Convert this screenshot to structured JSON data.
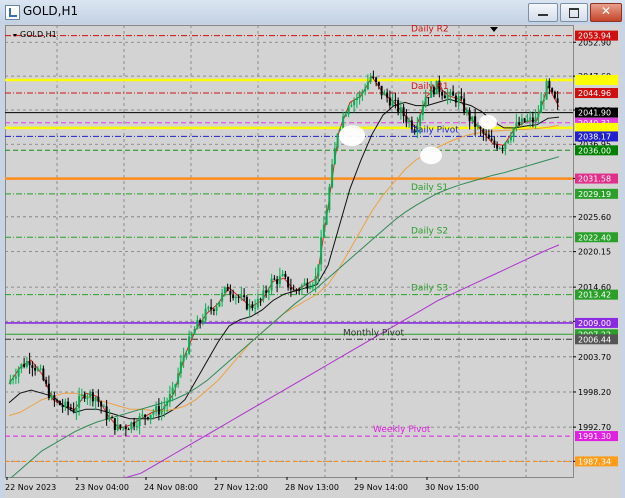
{
  "window": {
    "title": "GOLD,H1"
  },
  "chart_label": "GOLD,H1",
  "chart_data": {
    "type": "line",
    "symbol": "GOLD",
    "timeframe": "H1",
    "ylim": [
      1984.9,
      2055.6
    ],
    "y_ticks": [
      "2052.90",
      "2047.60",
      "2042.30",
      "2036.95",
      "2031.60",
      "2025.60",
      "2020.15",
      "2014.60",
      "2009.25",
      "2003.70",
      "1998.20",
      "1992.70",
      "1987.35"
    ],
    "x_ticks": [
      "22 Nov 2023",
      "23 Nov 04:00",
      "24 Nov 08:00",
      "27 Nov 12:00",
      "28 Nov 13:00",
      "29 Nov 14:00",
      "30 Nov 15:00"
    ],
    "series": [
      {
        "values": [
          1999.5,
          2002.0,
          2003.2,
          2001.0,
          1997.0,
          1996.0,
          1995.5,
          1998.0,
          1997.5,
          1994.5,
          1992.5,
          1993.0,
          1994.0,
          1995.0,
          1995.5,
          1998.0,
          2004.0,
          2008.0,
          2010.5,
          2012.0,
          2014.5,
          2013.0,
          2011.5,
          2012.5,
          2015.5,
          2016.0,
          2014.0,
          2015.0,
          2016.0,
          2027.0,
          2039.0,
          2043.5,
          2044.5,
          2047.5,
          2045.0,
          2043.5,
          2041.5,
          2039.5,
          2044.5,
          2046.0,
          2044.5,
          2044.0,
          2041.0,
          2039.0,
          2037.0,
          2036.8,
          2039.5,
          2040.5,
          2040.7,
          2046.0,
          2042.8
        ]
      },
      {
        "values": [
          1996.5,
          1998.0,
          1998.5,
          1998.0,
          1997.5,
          1996.0,
          1995.0,
          1995.5,
          1995.5,
          1995.0,
          1994.5,
          1994.0,
          1994.0,
          1994.0,
          1994.5,
          1995.5,
          1997.0,
          2000.0,
          2003.0,
          2006.0,
          2008.5,
          2009.5,
          2010.0,
          2011.0,
          2012.5,
          2013.5,
          2014.0,
          2014.5,
          2015.0,
          2018.0,
          2024.0,
          2030.0,
          2034.5,
          2038.5,
          2041.5,
          2043.0,
          2043.5,
          2043.0,
          2043.0,
          2043.5,
          2044.0,
          2043.5,
          2043.0,
          2042.0,
          2040.5,
          2039.5,
          2039.5,
          2039.8,
          2040.0,
          2041.0,
          2041.2
        ]
      },
      {
        "values": [
          1994.5,
          1995.0,
          1996.0,
          1997.0,
          1997.5,
          1998.0,
          1998.0,
          1997.5,
          1997.0,
          1996.5,
          1996.0,
          1995.5,
          1995.5,
          1995.3,
          1995.2,
          1995.5,
          1996.0,
          1997.0,
          1998.5,
          2000.0,
          2002.0,
          2004.0,
          2006.0,
          2007.5,
          2009.0,
          2010.5,
          2011.5,
          2012.5,
          2013.5,
          2015.0,
          2017.5,
          2020.5,
          2023.5,
          2026.5,
          2029.0,
          2031.0,
          2033.0,
          2034.5,
          2035.5,
          2036.5,
          2037.3,
          2038.0,
          2038.5,
          2038.8,
          2039.0,
          2039.1,
          2039.2,
          2039.3,
          2039.4,
          2039.6,
          2039.9
        ]
      },
      {
        "values": [
          1984.5,
          1986.0,
          1987.5,
          1989.0,
          1990.0,
          1991.0,
          1992.0,
          1992.8,
          1993.5,
          1994.0,
          1994.5,
          1995.0,
          1995.5,
          1996.0,
          1996.5,
          1997.0,
          1997.8,
          1998.8,
          2000.0,
          2001.5,
          2003.0,
          2004.5,
          2006.0,
          2007.5,
          2009.0,
          2010.5,
          2012.0,
          2013.3,
          2014.5,
          2016.0,
          2017.5,
          2019.0,
          2020.5,
          2022.0,
          2023.5,
          2025.0,
          2026.3,
          2027.4,
          2028.4,
          2029.3,
          2030.0,
          2030.6,
          2031.1,
          2031.6,
          2032.1,
          2032.5,
          2033.0,
          2033.5,
          2034.0,
          2034.5,
          2035.0
        ]
      },
      {
        "values": [
          1984.0,
          1984.5,
          1985.0,
          1985.5,
          1986.5,
          1987.5,
          1988.5,
          1989.5,
          1990.5,
          1991.5,
          1992.5,
          1993.5,
          1994.5,
          1995.5,
          1996.5,
          1997.5,
          1998.5,
          1999.5,
          2000.5,
          2001.5,
          2002.5,
          2003.5,
          2004.5,
          2005.5,
          2006.5,
          2007.5,
          2008.5,
          2009.5,
          2010.5,
          2011.5,
          2012.5,
          2013.3,
          2014.1,
          2014.9,
          2015.7,
          2016.5,
          2017.3,
          2018.1,
          2018.9,
          2019.7,
          2020.5,
          2021.2
        ]
      }
    ],
    "levels": [
      {
        "label": "Daily R2",
        "value": 2053.94,
        "color": "#d01010",
        "style": "dashdot",
        "tag": "2053.94",
        "tagBg": "#d01010"
      },
      {
        "label": "",
        "value": 2047.0,
        "color": "#ffff00",
        "style": "solid",
        "tag": "",
        "tagBg": "#ffff00"
      },
      {
        "label": "Daily R1",
        "value": 2044.96,
        "color": "#d01010",
        "style": "dashdot",
        "tag": "2044.96",
        "tagBg": "#d01010"
      },
      {
        "label": "",
        "value": 2041.9,
        "color": "#000000",
        "style": "solid",
        "tag": "2041.90",
        "tagBg": "#000000"
      },
      {
        "label": "",
        "value": 2040.31,
        "color": "#e040e0",
        "style": "dashed",
        "tag": "2040.31",
        "tagBg": "#e040e0"
      },
      {
        "label": "",
        "value": 2039.5,
        "color": "#ffff00",
        "style": "solid",
        "tag": "",
        "tagBg": "#ffff00"
      },
      {
        "label": "Daily Pivot",
        "value": 2038.17,
        "color": "#2020d0",
        "style": "dashdot",
        "tag": "2038.17",
        "tagBg": "#2020d0"
      },
      {
        "label": "",
        "value": 2036.0,
        "color": "#1a8a1a",
        "style": "dashed",
        "tag": "2036.00",
        "tagBg": "#008000"
      },
      {
        "label": "",
        "value": 2031.58,
        "color": "#ff8c1a",
        "style": "solid",
        "tag": "2031.58",
        "tagBg": "#e0308a"
      },
      {
        "label": "Daily S1",
        "value": 2029.19,
        "color": "#2aa02a",
        "style": "dashdot",
        "tag": "2029.19",
        "tagBg": "#2aa02a"
      },
      {
        "label": "Daily S2",
        "value": 2022.4,
        "color": "#2aa02a",
        "style": "dashdot",
        "tag": "2022.40",
        "tagBg": "#2aa02a"
      },
      {
        "label": "Daily S3",
        "value": 2013.42,
        "color": "#2aa02a",
        "style": "dashdot",
        "tag": "2013.42",
        "tagBg": "#2aa02a"
      },
      {
        "label": "",
        "value": 2009.0,
        "color": "#8a2be2",
        "style": "solid",
        "tag": "2009.00",
        "tagBg": "#8a2be2"
      },
      {
        "label": "",
        "value": 2007.22,
        "color": "#2aa02a",
        "style": "solid",
        "tag": "2007.22",
        "tagBg": "#2aa02a"
      },
      {
        "label": "Monthly Pivot",
        "value": 2006.44,
        "color": "#333333",
        "style": "dashdot",
        "tag": "2006.44",
        "tagBg": "#555555"
      },
      {
        "label": "Weekly Pivot",
        "value": 1991.3,
        "color": "#e020e0",
        "style": "dashed",
        "tag": "1991.30",
        "tagBg": "#e020e0"
      },
      {
        "label": "",
        "value": 1987.34,
        "color": "#ff8c1a",
        "style": "dashed",
        "tag": "1987.34",
        "tagBg": "#ff9c1a"
      }
    ],
    "grid": true
  },
  "colors": {
    "chart_bg": "#d3d3d3",
    "grid": "#7a7a7a",
    "up_candle": "#00b050",
    "down_candle": "#000000",
    "ma_fast": "#e02020",
    "ma_mid": "#111111",
    "ma_orange": "#f0a040",
    "ma_green": "#2e8b57",
    "ma_purple": "#b030d0"
  }
}
